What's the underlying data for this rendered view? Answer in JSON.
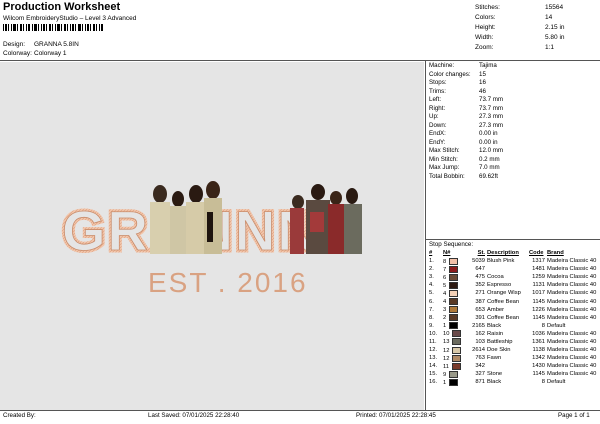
{
  "header": {
    "title": "Production Worksheet",
    "subtitle": "Wilcom EmbroideryStudio – Level 3 Advanced",
    "design_label": "Design:",
    "design_value": "GRANNA 5.8IN",
    "colorway_label": "Colorway:",
    "colorway_value": "Colorway 1"
  },
  "stats": [
    {
      "k": "Stitches:",
      "v": "15564"
    },
    {
      "k": "Colors:",
      "v": "14"
    },
    {
      "k": "Height:",
      "v": "2.15 in"
    },
    {
      "k": "Width:",
      "v": "5.80 in"
    },
    {
      "k": "Zoom:",
      "v": "1:1"
    }
  ],
  "machine": [
    {
      "k": "Machine:",
      "v": "Tajima"
    },
    {
      "k": "Color changes:",
      "v": "15"
    },
    {
      "k": "Stops:",
      "v": "16"
    },
    {
      "k": "Trims:",
      "v": "46"
    },
    {
      "k": "Left:",
      "v": "73.7 mm"
    },
    {
      "k": "Right:",
      "v": "73.7 mm"
    },
    {
      "k": "Up:",
      "v": "27.3 mm"
    },
    {
      "k": "Down:",
      "v": "27.3 mm"
    },
    {
      "k": "EndX:",
      "v": "0.00 in"
    },
    {
      "k": "EndY:",
      "v": "0.00 in"
    },
    {
      "k": "Max Stitch:",
      "v": "12.0 mm"
    },
    {
      "k": "Min Stitch:",
      "v": "0.2 mm"
    },
    {
      "k": "Max Jump:",
      "v": "7.0 mm"
    },
    {
      "k": "Total Bobbin:",
      "v": "69.62ft"
    }
  ],
  "sequence": {
    "heading": "Stop Sequence:",
    "columns": [
      "#",
      "N#",
      "St.",
      "Description",
      "Code",
      "Brand"
    ],
    "rows": [
      {
        "num": "1.",
        "n": "8",
        "color": "#f2c0a8",
        "st": "5039",
        "desc": "Blush Pink",
        "code": "1317",
        "brand": "Madeira Classic 40"
      },
      {
        "num": "2.",
        "n": "7",
        "color": "#8b1a1a",
        "st": "647",
        "desc": "",
        "code": "1481",
        "brand": "Madeira Classic 40"
      },
      {
        "num": "3.",
        "n": "6",
        "color": "#6b4a35",
        "st": "475",
        "desc": "Cocoa",
        "code": "1259",
        "brand": "Madeira Classic 40"
      },
      {
        "num": "4.",
        "n": "5",
        "color": "#2e1a12",
        "st": "352",
        "desc": "Espresso",
        "code": "1131",
        "brand": "Madeira Classic 40"
      },
      {
        "num": "5.",
        "n": "4",
        "color": "#f5d2b8",
        "st": "271",
        "desc": "Orange Wisp",
        "code": "1017",
        "brand": "Madeira Classic 40"
      },
      {
        "num": "6.",
        "n": "4",
        "color": "#5a3a26",
        "st": "387",
        "desc": "Coffee Bean",
        "code": "1145",
        "brand": "Madeira Classic 40"
      },
      {
        "num": "7.",
        "n": "3",
        "color": "#b07a3a",
        "st": "653",
        "desc": "Amber",
        "code": "1226",
        "brand": "Madeira Classic 40"
      },
      {
        "num": "8.",
        "n": "2",
        "color": "#5a3a26",
        "st": "391",
        "desc": "Coffee Bean",
        "code": "1145",
        "brand": "Madeira Classic 40"
      },
      {
        "num": "9.",
        "n": "1",
        "color": "#000000",
        "st": "2165",
        "desc": "Black",
        "code": "8",
        "brand": "Default"
      },
      {
        "num": "10.",
        "n": "10",
        "color": "#6a4a4a",
        "st": "162",
        "desc": "Raisin",
        "code": "1036",
        "brand": "Madeira Classic 40"
      },
      {
        "num": "11.",
        "n": "13",
        "color": "#6b6b5e",
        "st": "103",
        "desc": "Battleship",
        "code": "1361",
        "brand": "Madeira Classic 40"
      },
      {
        "num": "12.",
        "n": "12",
        "color": "#d8c8a8",
        "st": "2614",
        "desc": "Doe Skin",
        "code": "1138",
        "brand": "Madeira Classic 40"
      },
      {
        "num": "13.",
        "n": "12",
        "color": "#b08a66",
        "st": "763",
        "desc": "Fawn",
        "code": "1342",
        "brand": "Madeira Classic 40"
      },
      {
        "num": "14.",
        "n": "11",
        "color": "#7a3a2a",
        "st": "342",
        "desc": "",
        "code": "1430",
        "brand": "Madeira Classic 40"
      },
      {
        "num": "15.",
        "n": "9",
        "color": "#9a9a8a",
        "st": "327",
        "desc": "Stone",
        "code": "1145",
        "brand": "Madeira Classic 40"
      },
      {
        "num": "16.",
        "n": "1",
        "color": "#000000",
        "st": "871",
        "desc": "Black",
        "code": "8",
        "brand": "Default"
      }
    ]
  },
  "design": {
    "main_text": "GRANNN",
    "sub_text": "EST . 2016",
    "thread_color": "#f0b89a"
  },
  "footer": {
    "created": "Created By:",
    "saved": "Last Saved: 07/01/2025 22:28:40",
    "printed": "Printed: 07/01/2025 22:28:45",
    "page": "Page 1 of 1"
  }
}
